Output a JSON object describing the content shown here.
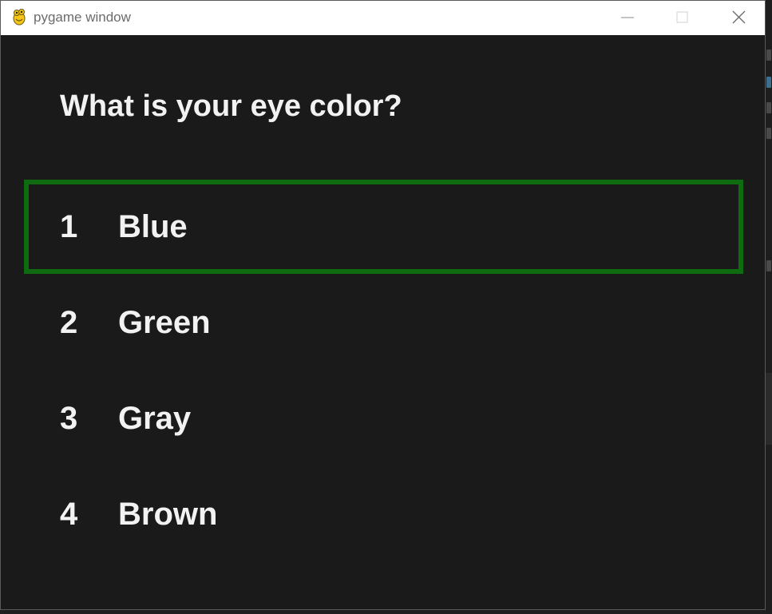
{
  "window": {
    "title": "pygame window",
    "app_icon": "pygame-snake-icon",
    "controls": {
      "minimize_icon": "minimize-icon",
      "maximize_icon": "maximize-icon",
      "close_icon": "close-icon"
    }
  },
  "quiz": {
    "question": "What is your eye color?",
    "selected_index": 0,
    "highlight_color": "#0f6b0f",
    "background_color": "#1a1a1a",
    "text_color": "#f2f2f2",
    "options": [
      {
        "number": "1",
        "label": "Blue"
      },
      {
        "number": "2",
        "label": "Green"
      },
      {
        "number": "3",
        "label": "Gray"
      },
      {
        "number": "4",
        "label": "Brown"
      }
    ]
  }
}
